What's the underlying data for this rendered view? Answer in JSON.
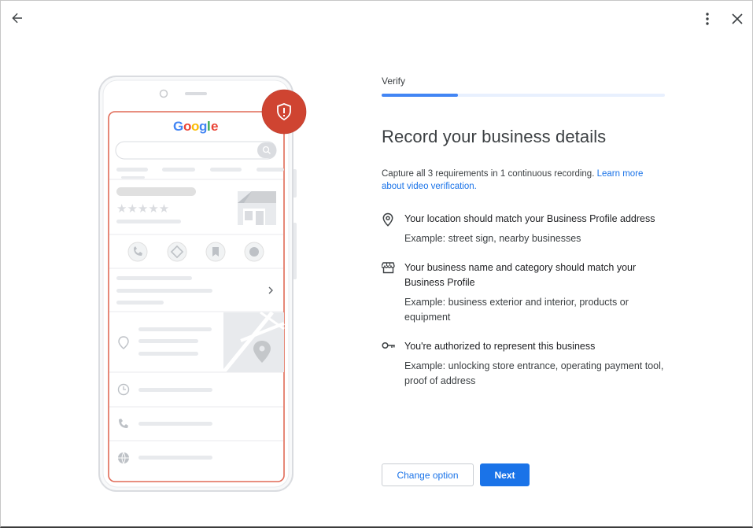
{
  "topbar": {
    "back_icon": "arrow-left-icon",
    "more_icon": "more-vert-icon",
    "close_icon": "close-icon"
  },
  "illustration": {
    "brand_logo": "Google",
    "badge_icon": "shield-alert-icon",
    "brand_colors": [
      "#4285F4",
      "#EA4335",
      "#FBBC05",
      "#34A853"
    ],
    "accent_red": "#D2412C"
  },
  "step": {
    "label": "Verify",
    "progress": 0.27
  },
  "title": "Record your business details",
  "intro": {
    "text": "Capture all 3 requirements in 1 continuous recording. ",
    "link": "Learn more about video verification."
  },
  "requirements": [
    {
      "icon": "location-pin-icon",
      "title": "Your location should match your Business Profile address",
      "example": "Example: street sign, nearby businesses"
    },
    {
      "icon": "storefront-icon",
      "title": "Your business name and category should match your Business Profile",
      "example": "Example: business exterior and interior, products or equipment"
    },
    {
      "icon": "key-icon",
      "title": "You're authorized to represent this business",
      "example": "Example: unlocking store entrance, operating payment tool, proof of address"
    }
  ],
  "actions": {
    "change_option": "Change option",
    "next": "Next"
  },
  "colors": {
    "primary": "#1a73e8",
    "progress_track": "#e8f0fe"
  }
}
